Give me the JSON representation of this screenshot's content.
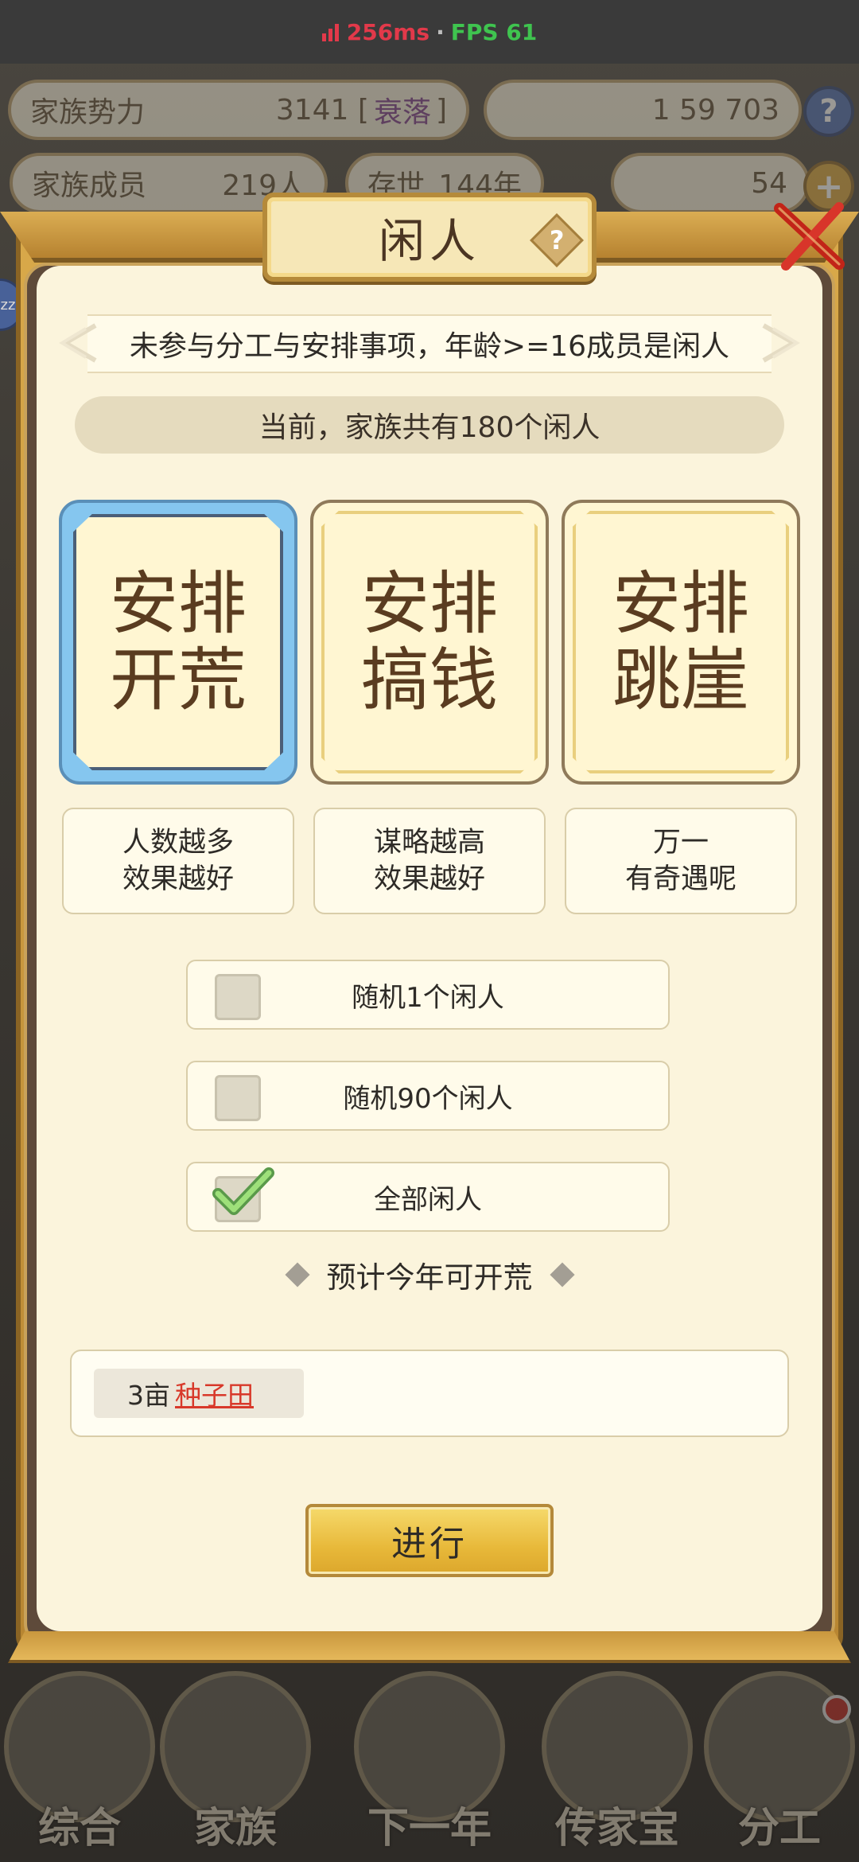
{
  "status": {
    "latency": "256ms",
    "separator": "·",
    "fps": "FPS 61"
  },
  "background": {
    "clan_power_label": "家族势力",
    "clan_power_value": "3141 [",
    "clan_power_tag": "衰落",
    "clan_power_close": "]",
    "currency_text": "1  59  703",
    "members_label": "家族成员",
    "members_value": "219人",
    "era_label": "存世",
    "era_value": "144年",
    "gold_value": "54",
    "help_symbol": "?",
    "plus_symbol": "+",
    "nav": [
      "综合",
      "家族",
      "下一年",
      "传家宝",
      "分工"
    ]
  },
  "modal": {
    "title": "闲人",
    "title_help": "?",
    "description": "未参与分工与安排事项，年龄>=16成员是闲人",
    "idle_count_text": "当前，家族共有180个闲人",
    "options": [
      {
        "label": "安排开荒",
        "hint": "人数越多\n效果越好",
        "selected": true
      },
      {
        "label": "安排搞钱",
        "hint": "谋略越高\n效果越好",
        "selected": false
      },
      {
        "label": "安排跳崖",
        "hint": "万一\n有奇遇呢",
        "selected": false
      }
    ],
    "choices": [
      {
        "label": "随机1个闲人",
        "checked": false
      },
      {
        "label": "随机90个闲人",
        "checked": false
      },
      {
        "label": "全部闲人",
        "checked": true
      }
    ],
    "forecast_text": "预计今年可开荒",
    "result": {
      "amount": "3亩",
      "item": "种子田"
    },
    "proceed_label": "进行"
  },
  "colors": {
    "accent_blue": "#85c6ef",
    "link_red": "#d8392a",
    "gold": "#e8b93a"
  }
}
